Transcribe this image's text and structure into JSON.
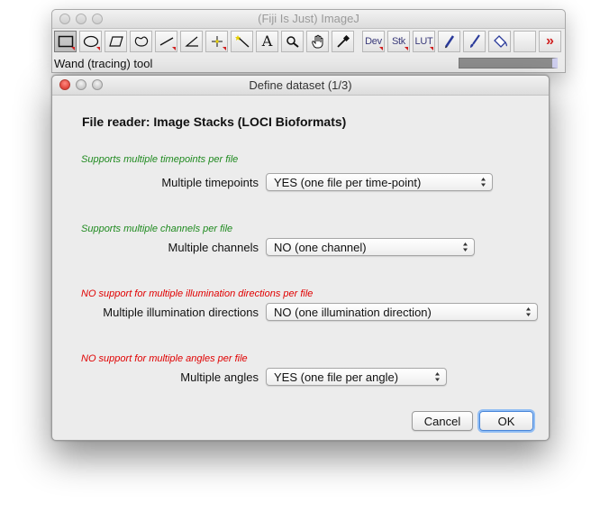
{
  "main_window": {
    "title": "(Fiji Is Just) ImageJ",
    "status": "Wand (tracing) tool",
    "toolbar": {
      "dev_label": "Dev",
      "stk_label": "Stk",
      "lut_label": "LUT",
      "text_tool_glyph": "A",
      "more_glyph": "»"
    },
    "icons": [
      "rectangle-icon",
      "oval-icon",
      "polygon-icon",
      "freehand-icon",
      "line-icon",
      "angle-icon",
      "point-icon",
      "wand-icon",
      "text-icon",
      "magnifier-icon",
      "hand-icon",
      "eyedropper-icon",
      "pencil-icon",
      "brush-icon",
      "flood-fill-icon",
      "more-tools-icon"
    ]
  },
  "dialog": {
    "window_title": "Define dataset (1/3)",
    "heading": "File reader: Image Stacks (LOCI Bioformats)",
    "sections": [
      {
        "hint": "Supports multiple timepoints per file",
        "label": "Multiple timepoints",
        "value": "YES (one file per time-point)"
      },
      {
        "hint": "Supports multiple channels per file",
        "label": "Multiple channels",
        "value": "NO (one channel)"
      },
      {
        "hint": "NO support for multiple illumination directions per file",
        "label": "Multiple illumination directions",
        "value": "NO (one illumination direction)"
      },
      {
        "hint": "NO support for multiple angles per file",
        "label": "Multiple angles",
        "value": "YES (one file per angle)"
      }
    ],
    "cancel_label": "Cancel",
    "ok_label": "OK"
  },
  "colors": {
    "supported_hint": "#1f8a1f",
    "unsupported_hint": "#e00000",
    "default_button_focus": "#90bdf4"
  }
}
